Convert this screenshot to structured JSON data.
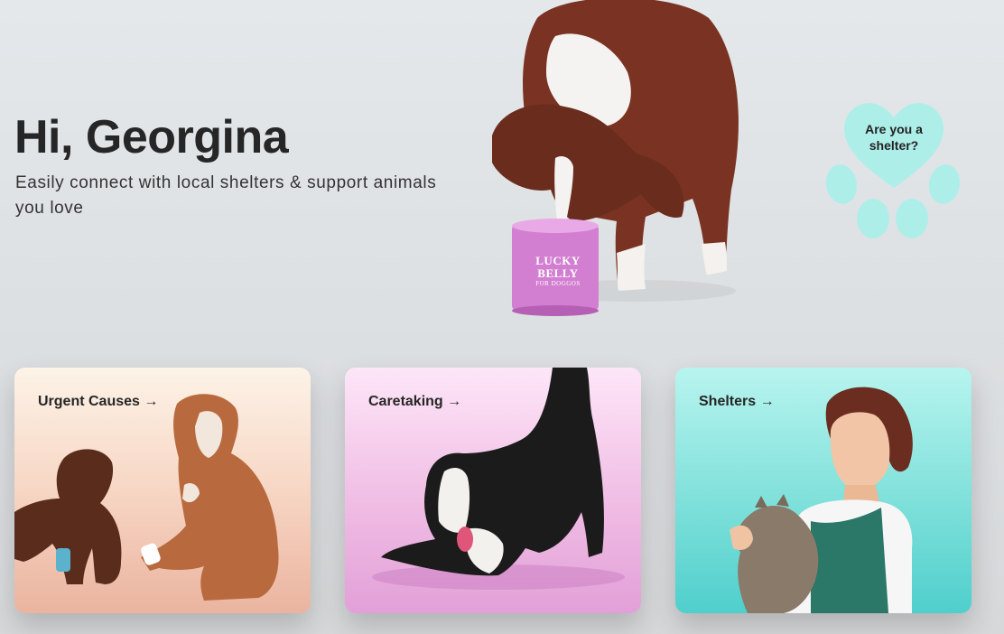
{
  "header": {
    "greeting": "Hi, Georgina",
    "subtitle": "Easily connect with local shelters & support animals you love"
  },
  "hero": {
    "image": "dog-eating-from-can",
    "can_brand": "LUCKY BELLY",
    "can_sub": "FOR DOGGOS"
  },
  "shelter_cta": {
    "label": "Are you a shelter?",
    "icon": "paw-heart-icon",
    "color": "#aeeee9"
  },
  "cards": [
    {
      "title": "Urgent Causes →",
      "image": "injured-puppy-and-dog",
      "color": "#f7d6c4"
    },
    {
      "title": "Caretaking →",
      "image": "border-collie-playing",
      "color": "#f0bde4"
    },
    {
      "title": "Shelters →",
      "image": "woman-holding-cat",
      "color": "#7fe0da"
    }
  ]
}
